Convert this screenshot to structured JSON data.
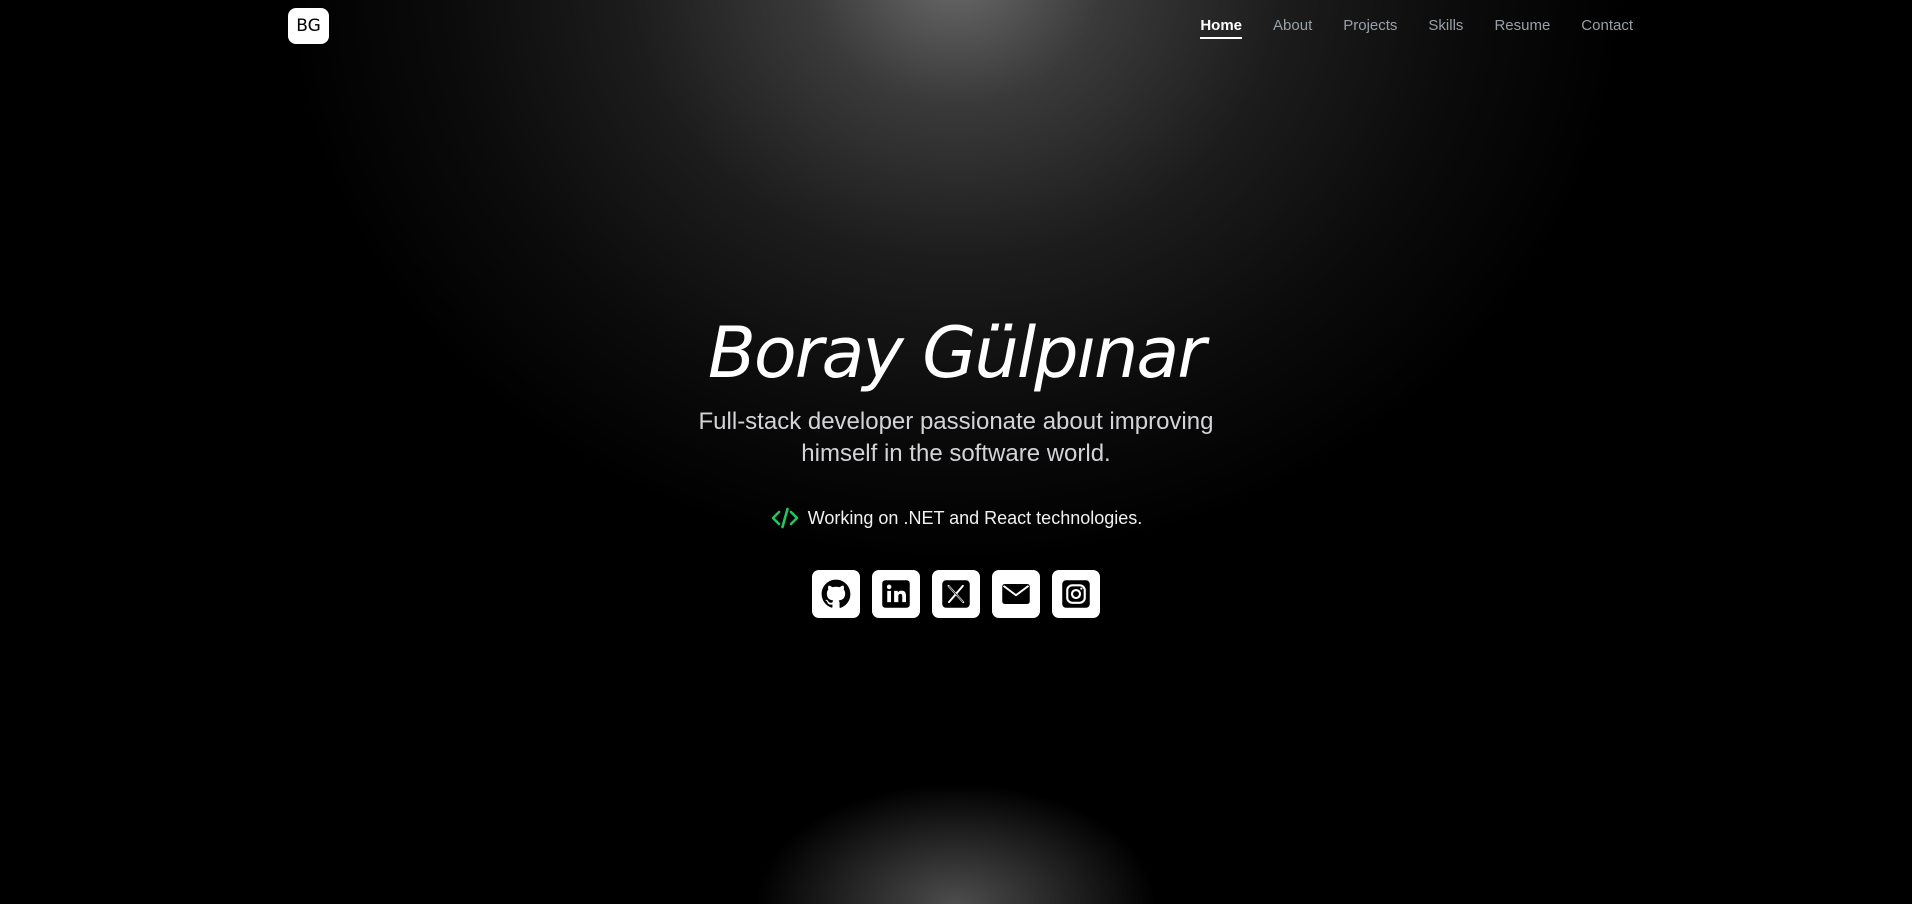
{
  "header": {
    "logo_text": "BG",
    "nav": [
      {
        "label": "Home",
        "active": true
      },
      {
        "label": "About",
        "active": false
      },
      {
        "label": "Projects",
        "active": false
      },
      {
        "label": "Skills",
        "active": false
      },
      {
        "label": "Resume",
        "active": false
      },
      {
        "label": "Contact",
        "active": false
      }
    ]
  },
  "hero": {
    "name": "Boray Gülpınar",
    "tagline": "Full-stack developer passionate about improving himself in the software world.",
    "working_text": "Working on .NET and React technologies.",
    "working_icon": "code-icon"
  },
  "socials": [
    {
      "icon": "github-icon"
    },
    {
      "icon": "linkedin-icon"
    },
    {
      "icon": "x-twitter-icon"
    },
    {
      "icon": "email-icon"
    },
    {
      "icon": "instagram-icon"
    }
  ],
  "colors": {
    "background": "#000000",
    "accent_green": "#22c55e",
    "nav_inactive": "#9aa0a8",
    "nav_active": "#ffffff"
  }
}
